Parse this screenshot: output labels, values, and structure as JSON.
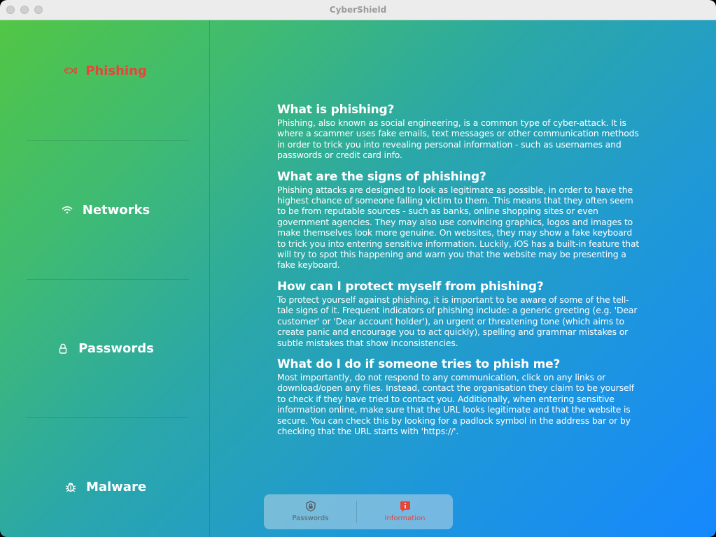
{
  "window": {
    "title": "CyberShield"
  },
  "sidebar": {
    "items": [
      {
        "label": "Phishing",
        "icon": "fish-icon",
        "active": true
      },
      {
        "label": "Networks",
        "icon": "wifi-icon",
        "active": false
      },
      {
        "label": "Passwords",
        "icon": "lock-icon",
        "active": false
      },
      {
        "label": "Malware",
        "icon": "bug-icon",
        "active": false
      }
    ]
  },
  "article": {
    "sections": [
      {
        "heading": "What is phishing?",
        "body": "Phishing, also known as social engineering, is a common type of cyber-attack. It is where a scammer uses fake emails, text messages or other communication methods in order to trick you into revealing personal information - such as usernames and passwords or credit card info."
      },
      {
        "heading": "What are the signs of phishing?",
        "body": "Phishing attacks are designed to look as legitimate as possible, in order to have the highest chance of someone falling victim to them. This means that they often seem to be from reputable sources - such as banks, online shopping sites or even government agencies. They may also use convincing graphics, logos and images to make themselves look more genuine. On websites, they may show a fake keyboard to trick you into entering sensitive information. Luckily, iOS has a built-in feature that will try to spot this happening and warn you that the website may be presenting a fake keyboard."
      },
      {
        "heading": "How can I protect myself from phishing?",
        "body": "To protect yourself against phishing, it is important to be aware of some of the tell-tale signs of it. Frequent indicators of phishing include: a generic greeting (e.g. 'Dear customer' or 'Dear account holder'), an urgent or threatening tone (which aims to create panic and encourage you to act quickly), spelling and grammar mistakes or subtle mistakes that show inconsistencies."
      },
      {
        "heading": "What do I do if someone tries to phish me?",
        "body": "Most importantly, do not respond to any communication, click on any links or download/open any files. Instead, contact the organisation they claim to be yourself to check if they have tried to contact you. Additionally, when entering sensitive information online, make sure that the URL looks legitimate and that the website is secure. You can check this by looking for a padlock symbol in the address bar or by checking that the URL starts with 'https://'."
      }
    ]
  },
  "tabbar": {
    "tabs": [
      {
        "label": "Passwords",
        "icon": "lock-shield-icon",
        "selected": false
      },
      {
        "label": "Information",
        "icon": "info-bubble-icon",
        "selected": true
      }
    ]
  },
  "colors": {
    "accent": "#e8443a",
    "tab_inactive": "#55606a",
    "gradient_start": "#52c645",
    "gradient_end": "#1688ff"
  }
}
